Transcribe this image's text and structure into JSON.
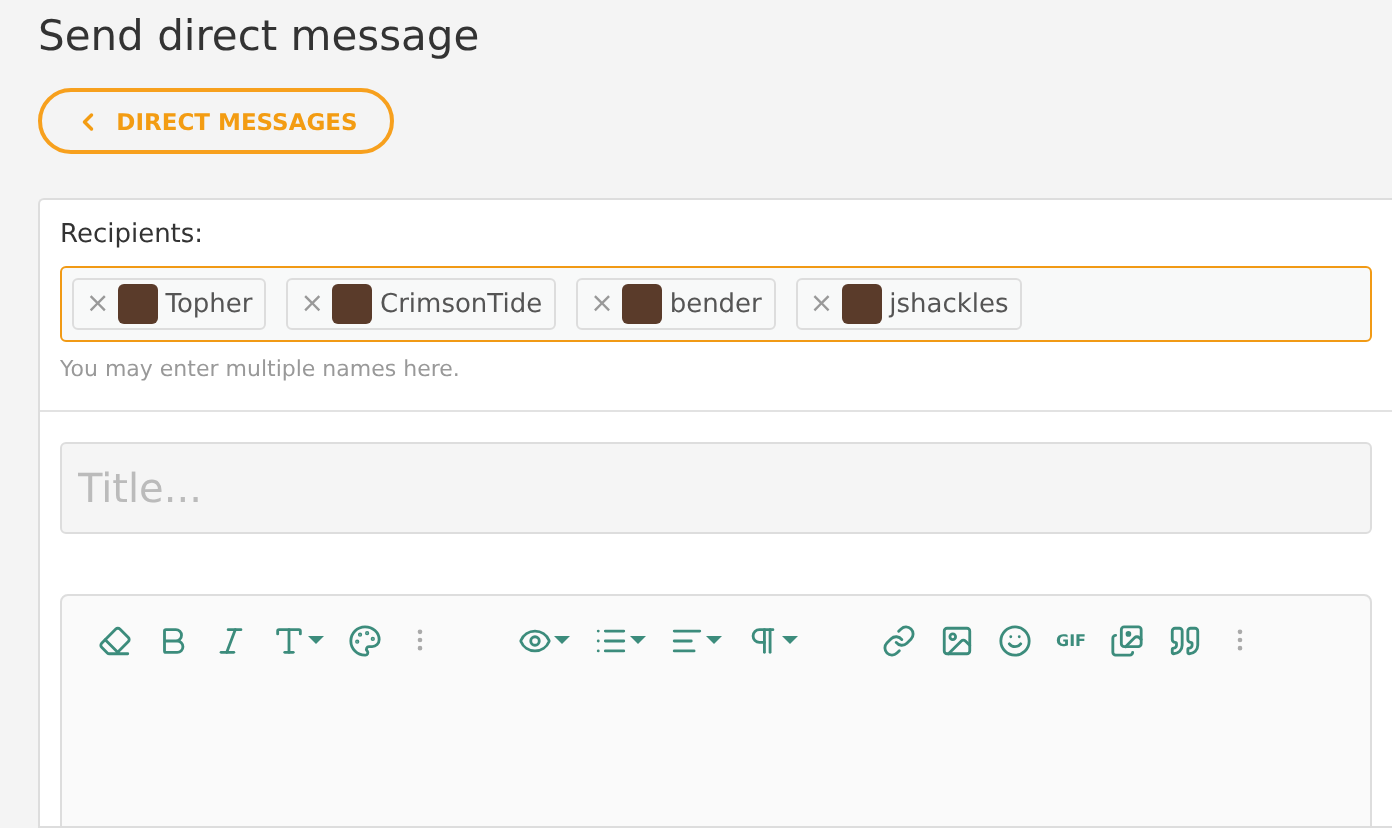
{
  "title": "Send direct message",
  "back_button": {
    "label": "DIRECT MESSAGES"
  },
  "recipients": {
    "label": "Recipients:",
    "tokens": [
      {
        "remove": "×",
        "name": "Topher"
      },
      {
        "remove": "×",
        "name": "CrimsonTide"
      },
      {
        "remove": "×",
        "name": "bender"
      },
      {
        "remove": "×",
        "name": "jshackles"
      }
    ],
    "hint": "You may enter multiple names here."
  },
  "title_field": {
    "placeholder": "Title..."
  },
  "toolbar": [
    {
      "kind": "icon"
    },
    {
      "kind": "icon"
    },
    {
      "kind": "icon"
    },
    {
      "kind": "menu"
    },
    {
      "kind": "icon"
    },
    {
      "kind": "more"
    },
    {
      "kind": "gap"
    },
    {
      "kind": "menu"
    },
    {
      "kind": "menu"
    },
    {
      "kind": "menu"
    },
    {
      "kind": "menu"
    },
    {
      "kind": "gap"
    },
    {
      "kind": "icon"
    },
    {
      "kind": "icon"
    },
    {
      "kind": "icon"
    },
    {
      "kind": "text",
      "label": "GIF"
    },
    {
      "kind": "icon"
    },
    {
      "kind": "icon"
    },
    {
      "kind": "more"
    }
  ]
}
